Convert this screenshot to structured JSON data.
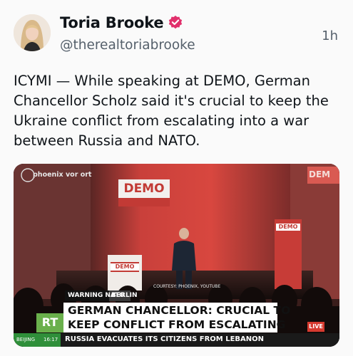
{
  "author": {
    "name": "Toria Brooke",
    "handle": "@therealtoriabrooke",
    "time": "1h",
    "verified": true,
    "verified_color": "#e1306c"
  },
  "tweet": {
    "text_lines": [
      "ICYMI — While speaking at DEMO, German",
      "Chancellor Scholz said it's crucial to keep the",
      "Ukraine conflict from escalating into a war",
      "between Russia and NATO."
    ]
  },
  "media": {
    "channel_logo": "phoenix vor ort",
    "stage_sign": "DEMO",
    "stage_sign_partial": "DEM",
    "podium_sign": "DEMO",
    "banner_sign": "DEMO",
    "credit": "COURTESY: PHOENIX, YOUTUBE",
    "tag_primary": "WARNING NATO",
    "tag_secondary": "BERLIN",
    "network_logo": "RT",
    "headline_1": "GERMAN CHANCELLOR: CRUCIAL TO",
    "headline_2": "KEEP CONFLICT FROM ESCALATING",
    "live_badge": "LIVE",
    "ticker_city": "BEIJING",
    "ticker_time": "16:17",
    "ticker_text": "RUSSIA EVACUATES ITS CITIZENS FROM LEBANON"
  }
}
